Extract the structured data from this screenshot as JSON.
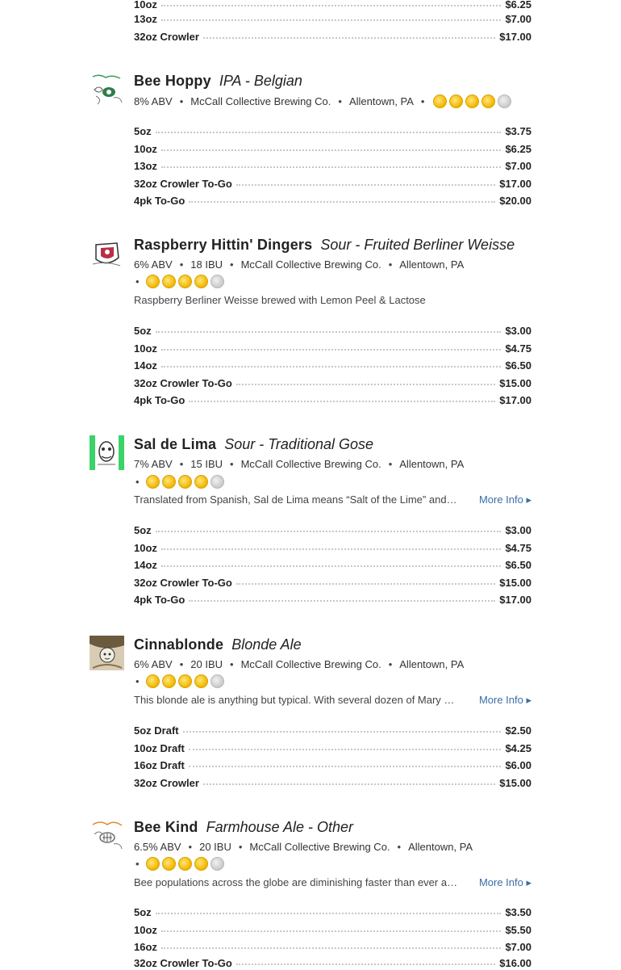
{
  "top_prices": [
    {
      "size": "10oz",
      "price": "$6.25"
    },
    {
      "size": "13oz",
      "price": "$7.00"
    },
    {
      "size": "32oz Crowler",
      "price": "$17.00"
    }
  ],
  "beers": [
    {
      "name": "Bee Hoppy",
      "style": "IPA - Belgian",
      "abv": "8% ABV",
      "brewery": "McCall Collective Brewing Co.",
      "location": "Allentown, PA",
      "rating_filled": 4,
      "rating_total": 5,
      "prices": [
        {
          "size": "5oz",
          "price": "$3.75"
        },
        {
          "size": "10oz",
          "price": "$6.25"
        },
        {
          "size": "13oz",
          "price": "$7.00"
        },
        {
          "size": "32oz Crowler To-Go",
          "price": "$17.00"
        },
        {
          "size": "4pk To-Go",
          "price": "$20.00"
        }
      ]
    },
    {
      "name": "Raspberry Hittin' Dingers",
      "style": "Sour - Fruited Berliner Weisse",
      "abv": "6% ABV",
      "ibu": "18 IBU",
      "brewery": "McCall Collective Brewing Co.",
      "location": "Allentown, PA",
      "rating_filled": 4,
      "rating_total": 5,
      "description": "Raspberry Berliner Weisse brewed with Lemon Peel & Lactose",
      "prices": [
        {
          "size": "5oz",
          "price": "$3.00"
        },
        {
          "size": "10oz",
          "price": "$4.75"
        },
        {
          "size": "14oz",
          "price": "$6.50"
        },
        {
          "size": "32oz Crowler To-Go",
          "price": "$15.00"
        },
        {
          "size": "4pk To-Go",
          "price": "$17.00"
        }
      ]
    },
    {
      "name": "Sal de Lima",
      "style": "Sour - Traditional Gose",
      "abv": "7% ABV",
      "ibu": "15 IBU",
      "brewery": "McCall Collective Brewing Co.",
      "location": "Allentown, PA",
      "rating_filled": 4,
      "rating_total": 5,
      "description": "Translated from Spanish, Sal de Lima means “Salt of the Lime” and…",
      "more": "More Info ▸",
      "prices": [
        {
          "size": "5oz",
          "price": "$3.00"
        },
        {
          "size": "10oz",
          "price": "$4.75"
        },
        {
          "size": "14oz",
          "price": "$6.50"
        },
        {
          "size": "32oz Crowler To-Go",
          "price": "$15.00"
        },
        {
          "size": "4pk To-Go",
          "price": "$17.00"
        }
      ]
    },
    {
      "name": "Cinnablonde",
      "style": "Blonde Ale",
      "abv": "6% ABV",
      "ibu": "20 IBU",
      "brewery": "McCall Collective Brewing Co.",
      "location": "Allentown, PA",
      "rating_filled": 4,
      "rating_total": 5,
      "description": "This blonde ale is anything but typical. With several dozen of Mary …",
      "more": "More Info ▸",
      "prices": [
        {
          "size": "5oz Draft",
          "price": "$2.50"
        },
        {
          "size": "10oz Draft",
          "price": "$4.25"
        },
        {
          "size": "16oz Draft",
          "price": "$6.00"
        },
        {
          "size": "32oz Crowler",
          "price": "$15.00"
        }
      ]
    },
    {
      "name": "Bee Kind",
      "style": "Farmhouse Ale - Other",
      "abv": "6.5% ABV",
      "ibu": "20 IBU",
      "brewery": "McCall Collective Brewing Co.",
      "location": "Allentown, PA",
      "rating_filled": 4,
      "rating_total": 5,
      "description": "Bee populations across the globe are diminishing faster than ever a…",
      "more": "More Info ▸",
      "prices": [
        {
          "size": "5oz",
          "price": "$3.50"
        },
        {
          "size": "10oz",
          "price": "$5.50"
        },
        {
          "size": "16oz",
          "price": "$7.00"
        },
        {
          "size": "32oz Crowler To-Go",
          "price": "$16.00"
        }
      ]
    }
  ],
  "colors": {
    "coin_full": "#f4b800",
    "coin_empty": "#c9c9c9",
    "link": "#3a6ea5"
  }
}
